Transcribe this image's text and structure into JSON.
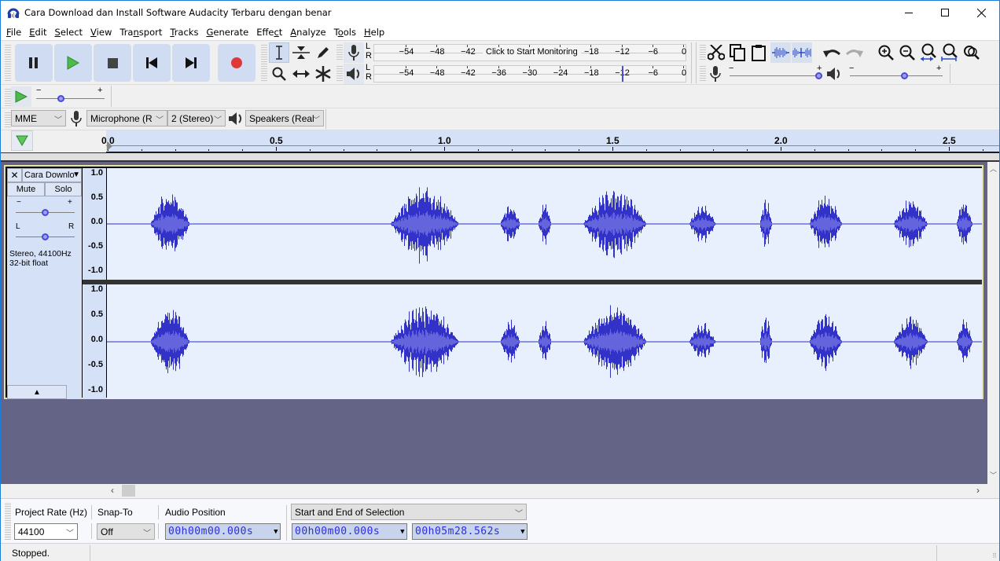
{
  "window": {
    "title": "Cara Download dan Install Software Audacity Terbaru dengan benar",
    "controls": {
      "minimize": "—",
      "maximize": "☐",
      "close": "✕"
    }
  },
  "menu": [
    {
      "label": "File",
      "u": "F",
      "rest": "ile"
    },
    {
      "label": "Edit",
      "u": "E",
      "rest": "dit"
    },
    {
      "label": "Select",
      "u": "S",
      "rest": "elect"
    },
    {
      "label": "View",
      "u": "V",
      "rest": "iew"
    },
    {
      "label": "Transport",
      "pre": "Tra",
      "u": "n",
      "rest": "sport"
    },
    {
      "label": "Tracks",
      "u": "T",
      "rest": "racks"
    },
    {
      "label": "Generate",
      "u": "G",
      "rest": "enerate"
    },
    {
      "label": "Effect",
      "pre": "Effe",
      "u": "c",
      "rest": "t"
    },
    {
      "label": "Analyze",
      "u": "A",
      "rest": "nalyze"
    },
    {
      "label": "Tools",
      "pre": "T",
      "u": "o",
      "rest": "ols"
    },
    {
      "label": "Help",
      "u": "H",
      "rest": "elp"
    }
  ],
  "transport": [
    "pause",
    "play",
    "stop",
    "skip-to-start",
    "skip-to-end",
    "record"
  ],
  "tools": [
    "selection",
    "envelope",
    "draw",
    "zoom",
    "time-shift",
    "multi"
  ],
  "record_meter": {
    "scale": [
      "-54",
      "-48",
      "-42",
      "-18",
      "-12",
      "-6",
      "0"
    ],
    "prompt": "Click to Start Monitoring",
    "channels": [
      "L",
      "R"
    ]
  },
  "play_meter": {
    "scale": [
      "-54",
      "-48",
      "-42",
      "-36",
      "-30",
      "-24",
      "-18",
      "-12",
      "-6",
      "0"
    ],
    "channels": [
      "L",
      "R"
    ],
    "peak_db": -12
  },
  "edit_tools": [
    "cut",
    "copy",
    "paste",
    "trim",
    "silence",
    "undo",
    "redo",
    "zoom-in",
    "zoom-out",
    "fit-selection",
    "fit-project",
    "zoom-toggle"
  ],
  "mixer": {
    "record_volume": 1.0,
    "playback_volume": 0.6,
    "minus": "−",
    "plus": "+"
  },
  "play_at_speed": {
    "speed": 0.35,
    "minus": "−",
    "plus": "+"
  },
  "device": {
    "host": "MME",
    "recording_device": "Microphone (R",
    "channels": "2 (Stereo)",
    "playback_device": "Speakers (Real"
  },
  "ruler": {
    "ticks": [
      "0.0",
      "0.5",
      "1.0",
      "1.5",
      "2.0",
      "2.5"
    ]
  },
  "track": {
    "name": "Cara Downlo",
    "mute": "Mute",
    "solo": "Solo",
    "gain_minus": "−",
    "gain_plus": "+",
    "pan_left": "L",
    "pan_right": "R",
    "gain": 0.5,
    "pan": 0.5,
    "info_line1": "Stereo, 44100Hz",
    "info_line2": "32-bit float",
    "scale": [
      "1.0",
      "0.5",
      "0.0",
      "-0.5",
      "-1.0"
    ]
  },
  "selection_toolbar": {
    "project_rate_label": "Project Rate (Hz)",
    "project_rate": "44100",
    "snap_label": "Snap-To",
    "snap": "Off",
    "audio_position_label": "Audio Position",
    "audio_position": "00h00m00.000s",
    "selection_mode": "Start and End of Selection",
    "selection_start": "00h00m00.000s",
    "selection_end": "00h05m28.562s"
  },
  "status": "Stopped.",
  "colors": {
    "wave": "#3232c8",
    "wave_rms": "#6464dc",
    "wave_bg": "#e8effd",
    "track_bg": "#646486",
    "panel": "#d4e1f7",
    "record": "#e03232",
    "play": "#3cb43c"
  }
}
